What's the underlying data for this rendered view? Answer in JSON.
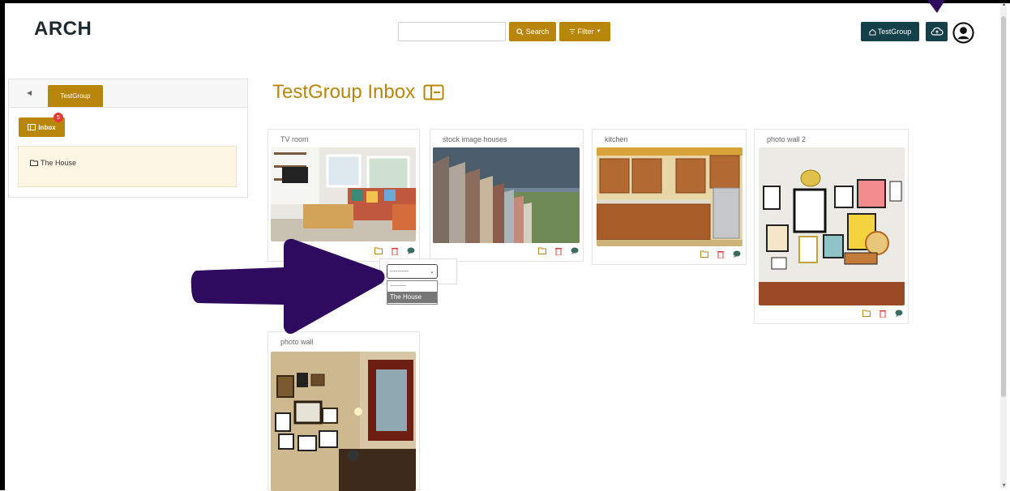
{
  "app": {
    "brand": "ARCH"
  },
  "header": {
    "search_placeholder": "",
    "search_label": "Search",
    "filter_label": "Filter",
    "group_label": "TestGroup"
  },
  "sidebar": {
    "group_tab": "TestGroup",
    "inbox_label": "Inbox",
    "inbox_count": "5",
    "folders": [
      {
        "label": "The House"
      }
    ]
  },
  "main": {
    "title": "TestGroup Inbox",
    "cards": [
      {
        "title": "TV room"
      },
      {
        "title": "stock image houses"
      },
      {
        "title": "kitchen"
      },
      {
        "title": "photo wall 2"
      },
      {
        "title": "photo wall"
      }
    ]
  },
  "dropdown": {
    "selected": "----------",
    "options": [
      "----------",
      "The House"
    ],
    "highlighted": "The House"
  },
  "colors": {
    "accent": "#b8860b",
    "dark_button": "#14404a",
    "annotation_arrow": "#2e0b5e",
    "delete_icon": "#e53935"
  }
}
